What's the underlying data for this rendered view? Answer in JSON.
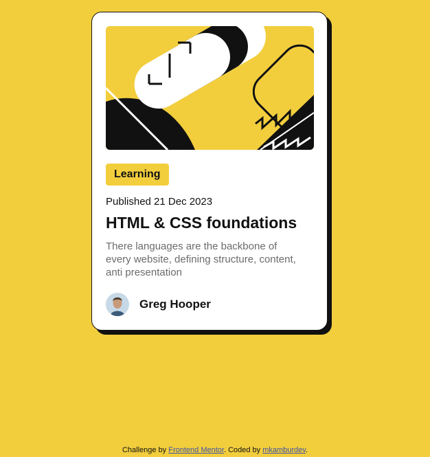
{
  "page": {
    "background_color": "#F2CE3D"
  },
  "card": {
    "image_alt": "illustration",
    "badge": "Learning",
    "published": "Published 21 Dec 2023",
    "title": "HTML & CSS foundations",
    "description": "There languages are the backbone of every website, defining structure, content, anti presentation",
    "author": {
      "name": "Greg Hooper",
      "avatar_icon": "avatar-icon"
    }
  },
  "footer": {
    "prefix": "Challenge by ",
    "link1": "Frontend Mentor",
    "middle": ". Coded by ",
    "link2": "mkamburdev",
    "suffix": "."
  }
}
